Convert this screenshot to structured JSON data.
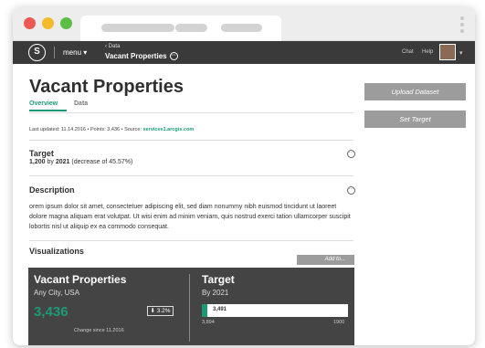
{
  "window": {
    "controls": [
      "close",
      "minimize",
      "maximize"
    ]
  },
  "nav": {
    "logo_glyph": "S",
    "menu_label": "menu",
    "breadcrumb_parent": "Data",
    "breadcrumb_title": "Vacant Properties",
    "chat_label": "Chat",
    "help_label": "Help"
  },
  "page": {
    "title": "Vacant Properties",
    "tabs": [
      {
        "label": "Overview",
        "active": true
      },
      {
        "label": "Data",
        "active": false
      }
    ],
    "meta": {
      "last_updated": "Last updated: 11.14.2016",
      "points": "Points: 3,436",
      "source_prefix": "Source:",
      "source_link": "services1.arcgis.com"
    },
    "target": {
      "heading": "Target",
      "value": "1,200",
      "by": "by",
      "year": "2021",
      "detail": "(decrease of 45.57%)"
    },
    "description": {
      "heading": "Description",
      "text": "orem ipsum dolor sit amet, consectetuer adipiscing elit, sed diam nonummy nibh euismod tincidunt ut laoreet dolore magna aliquam erat volutpat. Ut wisi enim ad minim veniam, quis nostrud exerci tation ullamcorper suscipit lobortis nisl ut aliquip ex ea commodo consequat."
    },
    "visualizations": {
      "heading": "Visualizations",
      "add_label": "Add to..."
    }
  },
  "card": {
    "title": "Vacant Properties",
    "location": "Any City, USA",
    "value": "3,436",
    "change_badge": "⬇ 3.2%",
    "change_note": "Change since 11.2016",
    "target_title": "Target",
    "target_sub": "By 2021",
    "bar_value_label": "3,491",
    "bar_fill_fraction": 0.04,
    "bar_min_label": "3,894",
    "bar_max_label": "1900"
  },
  "sidebar": {
    "upload_label": "Upload Dataset",
    "set_target_label": "Set Target"
  },
  "colors": {
    "accent": "#1c9a78",
    "nav": "#3a3a3a",
    "card": "#444444",
    "button": "#9c9c9c"
  }
}
